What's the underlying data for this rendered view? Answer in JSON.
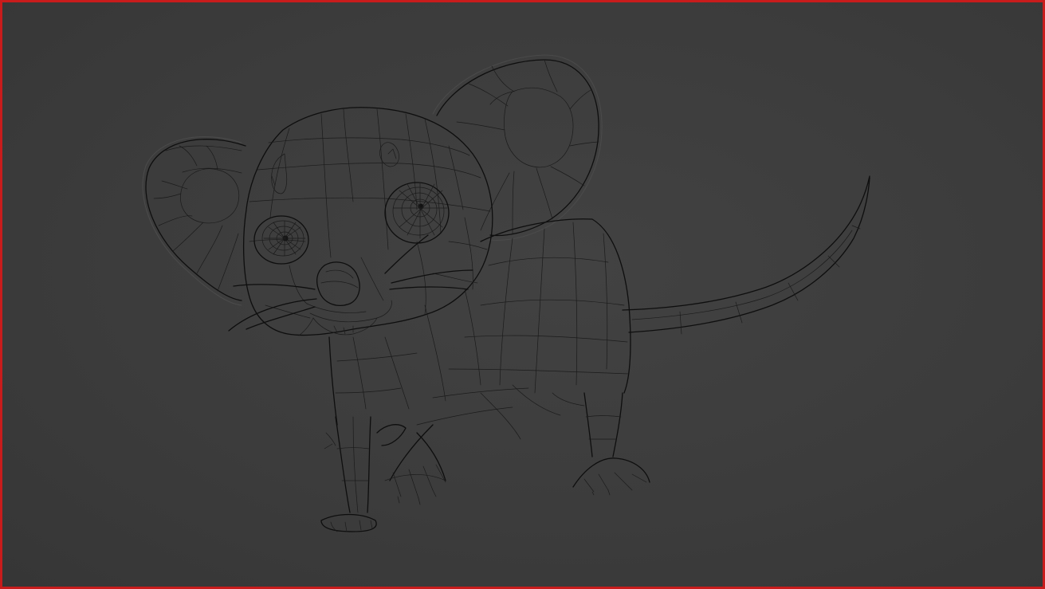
{
  "viewport": {
    "frame_color": "#c81c1c",
    "background_color": "#3d3d3d",
    "wire_color": "#121212"
  },
  "scene": {
    "object_icon": "mouse-wireframe-model"
  }
}
